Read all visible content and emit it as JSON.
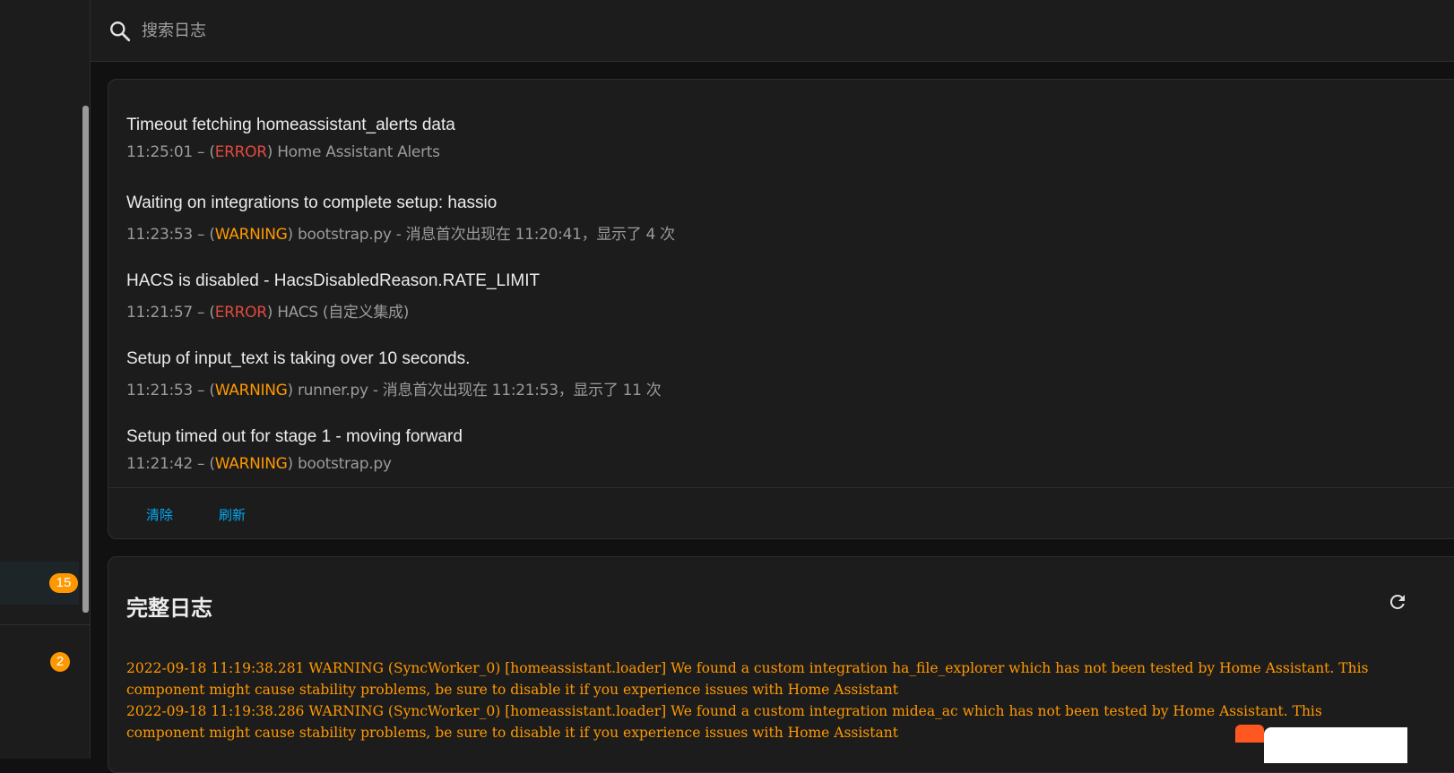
{
  "search": {
    "placeholder": "搜索日志"
  },
  "sidebar": {
    "badge_logs": "15",
    "badge_notifications": "2"
  },
  "system_log": {
    "entries": [
      {
        "title": "Timeout fetching homeassistant_alerts data",
        "time": "11:25:01",
        "level": "ERROR",
        "source": "Home Assistant Alerts"
      },
      {
        "title": "Waiting on integrations to complete setup: hassio",
        "time": "11:23:53",
        "level": "WARNING",
        "source": "bootstrap.py - 消息首次出现在 11:20:41，显示了 4 次"
      },
      {
        "title": "HACS is disabled - HacsDisabledReason.RATE_LIMIT",
        "time": "11:21:57",
        "level": "ERROR",
        "source": "HACS (自定义集成)"
      },
      {
        "title": "Setup of input_text is taking over 10 seconds.",
        "time": "11:21:53",
        "level": "WARNING",
        "source": "runner.py - 消息首次出现在 11:21:53，显示了 11 次"
      },
      {
        "title": "Setup timed out for stage 1 - moving forward",
        "time": "11:21:42",
        "level": "WARNING",
        "source": "bootstrap.py"
      }
    ],
    "meta_sep": " – (",
    "meta_close": ") ",
    "clear_label": "清除",
    "refresh_label": "刷新"
  },
  "full_log": {
    "title": "完整日志",
    "lines": [
      "2022-09-18 11:19:38.281 WARNING (SyncWorker_0) [homeassistant.loader] We found a custom integration ha_file_explorer which has not been tested by Home Assistant. This",
      "component might cause stability problems, be sure to disable it if you experience issues with Home Assistant",
      "2022-09-18 11:19:38.286 WARNING (SyncWorker_0) [homeassistant.loader] We found a custom integration midea_ac which has not been tested by Home Assistant. This",
      "component might cause stability problems, be sure to disable it if you experience issues with Home Assistant"
    ]
  },
  "colors": {
    "error": "#e04a3f",
    "warning": "#ff9800",
    "accent": "#03a9f4",
    "badge": "#ff9800"
  }
}
